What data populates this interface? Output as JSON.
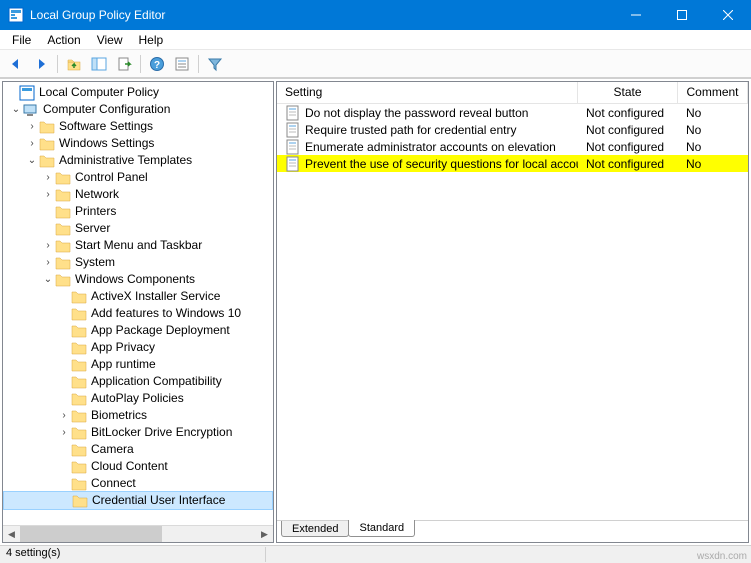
{
  "window": {
    "title": "Local Group Policy Editor"
  },
  "menu": {
    "file": "File",
    "action": "Action",
    "view": "View",
    "help": "Help"
  },
  "tree": {
    "root": "Local Computer Policy",
    "cc": "Computer Configuration",
    "soft": "Software Settings",
    "win": "Windows Settings",
    "admin": "Administrative Templates",
    "cp": "Control Panel",
    "net": "Network",
    "printers": "Printers",
    "server": "Server",
    "smtb": "Start Menu and Taskbar",
    "system": "System",
    "wcomp": "Windows Components",
    "ax": "ActiveX Installer Service",
    "addfeat": "Add features to Windows 10",
    "appkg": "App Package Deployment",
    "apriv": "App Privacy",
    "aruntime": "App runtime",
    "appcompat": "Application Compatibility",
    "autoplay": "AutoPlay Policies",
    "biometrics": "Biometrics",
    "bitlocker": "BitLocker Drive Encryption",
    "camera": "Camera",
    "cloud": "Cloud Content",
    "connect": "Connect",
    "credui": "Credential User Interface"
  },
  "listHeaders": {
    "setting": "Setting",
    "state": "State",
    "comment": "Comment"
  },
  "policies": [
    {
      "name": "Do not display the password reveal button",
      "state": "Not configured",
      "comment": "No",
      "hl": false
    },
    {
      "name": "Require trusted path for credential entry",
      "state": "Not configured",
      "comment": "No",
      "hl": false
    },
    {
      "name": "Enumerate administrator accounts on elevation",
      "state": "Not configured",
      "comment": "No",
      "hl": false
    },
    {
      "name": "Prevent the use of security questions for local accounts",
      "state": "Not configured",
      "comment": "No",
      "hl": true
    }
  ],
  "tabs": {
    "extended": "Extended",
    "standard": "Standard"
  },
  "status": "4 setting(s)",
  "watermark": "wsxdn.com"
}
